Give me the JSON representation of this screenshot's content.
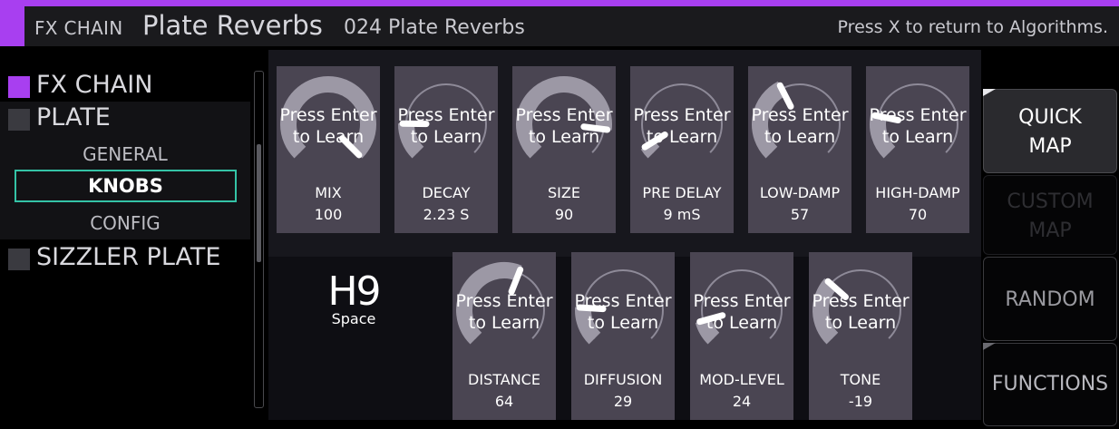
{
  "colors": {
    "accent": "#a83ff0",
    "selection": "#34c3a6",
    "knob_ring": "#9c98a5",
    "pointer": "#ffffff"
  },
  "header": {
    "chain_label": "FX CHAIN",
    "algorithm": "Plate Reverbs",
    "preset": "024 Plate Reverbs",
    "hint": "Press X to return to Algorithms."
  },
  "nav": {
    "fx_chain": "FX CHAIN",
    "plate": "PLATE",
    "general": "GENERAL",
    "knobs": "KNOBS",
    "config": "CONFIG",
    "sizzler": "SIZZLER PLATE"
  },
  "learn_text": {
    "line1": "Press Enter",
    "line2": "to Learn"
  },
  "knobs_row1": [
    {
      "label": "MIX",
      "value": "100",
      "position": 1.0
    },
    {
      "label": "DECAY",
      "value": "2.23 S",
      "position": 0.17
    },
    {
      "label": "SIZE",
      "value": "90",
      "position": 0.86
    },
    {
      "label": "PRE DELAY",
      "value": "9 mS",
      "position": 0.05
    },
    {
      "label": "LOW-DAMP",
      "value": "57",
      "position": 0.4
    },
    {
      "label": "HIGH-DAMP",
      "value": "70",
      "position": 0.21
    }
  ],
  "knobs_row2": [
    {
      "label": "DISTANCE",
      "value": "64",
      "position": 0.58
    },
    {
      "label": "DIFFUSION",
      "value": "29",
      "position": 0.18
    },
    {
      "label": "MOD-LEVEL",
      "value": "24",
      "position": 0.11
    },
    {
      "label": "TONE",
      "value": "-19",
      "position": 0.32
    }
  ],
  "logo": {
    "main": "H9",
    "sub": "Space"
  },
  "side_buttons": [
    {
      "line1": "QUICK",
      "line2": "MAP"
    },
    {
      "line1": "CUSTOM",
      "line2": "MAP"
    },
    {
      "line1": "RANDOM"
    },
    {
      "line1": "FUNCTIONS"
    }
  ]
}
